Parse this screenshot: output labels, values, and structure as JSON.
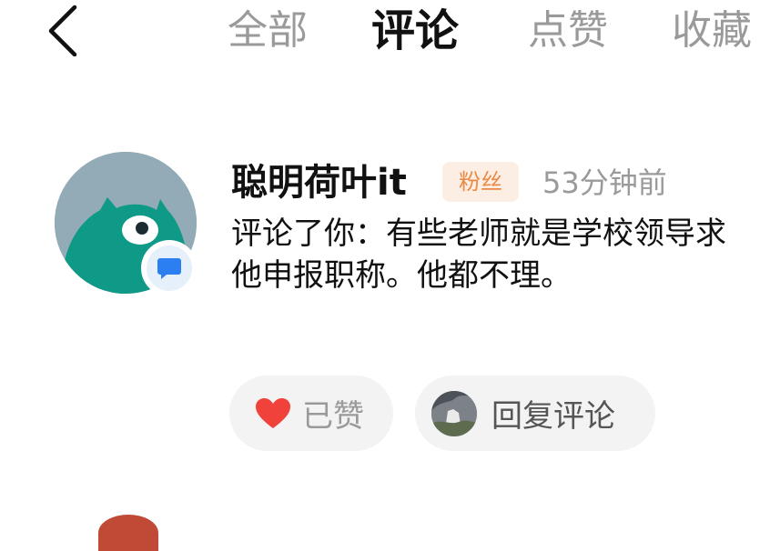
{
  "nav": {
    "back_icon": "chevron-left-icon",
    "tabs": [
      {
        "label": "全部",
        "active": false
      },
      {
        "label": "评论",
        "active": true
      },
      {
        "label": "点赞",
        "active": false
      },
      {
        "label": "收藏",
        "active": false
      }
    ]
  },
  "notification": {
    "username": "聪明荷叶it",
    "badge": "粉丝",
    "time": "53分钟前",
    "text": "评论了你：有些老师就是学校领导求他申报职称。他都不理。",
    "like_label": "已赞",
    "reply_label": "回复评论"
  },
  "colors": {
    "active_tab": "#111111",
    "inactive_tab": "#9a9a9a",
    "badge_bg": "#fdeee4",
    "badge_text": "#e98a45",
    "heart": "#f0413a",
    "pill_bg": "#f3f3f3",
    "avatar_bg": "#93aab7",
    "avatar_creature": "#0f9a88"
  }
}
